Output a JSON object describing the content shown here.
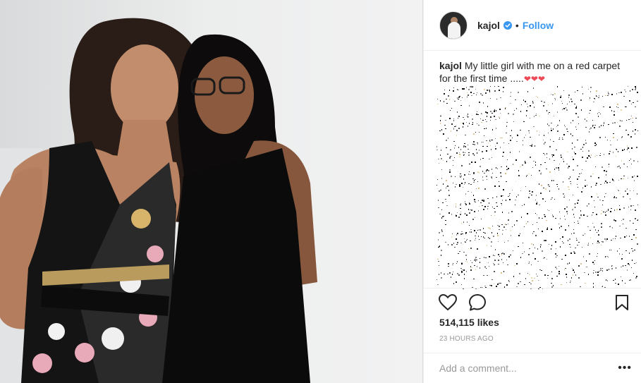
{
  "header": {
    "username": "kajol",
    "separator": "•",
    "follow_label": "Follow"
  },
  "caption": {
    "username": "kajol",
    "text": "My little girl with me on a red carpet for the first time .....",
    "hearts": "❤❤❤"
  },
  "actions": {
    "icons": [
      "heart-icon",
      "comment-icon",
      "bookmark-icon"
    ]
  },
  "likes": {
    "label": "514,115 likes"
  },
  "timestamp": "23 HOURS AGO",
  "comment_bar": {
    "placeholder": "Add a comment...",
    "more_label": "•••"
  },
  "colors": {
    "accent": "#3897f0",
    "heart": "#ed4956",
    "muted": "#999999",
    "text": "#262626"
  }
}
